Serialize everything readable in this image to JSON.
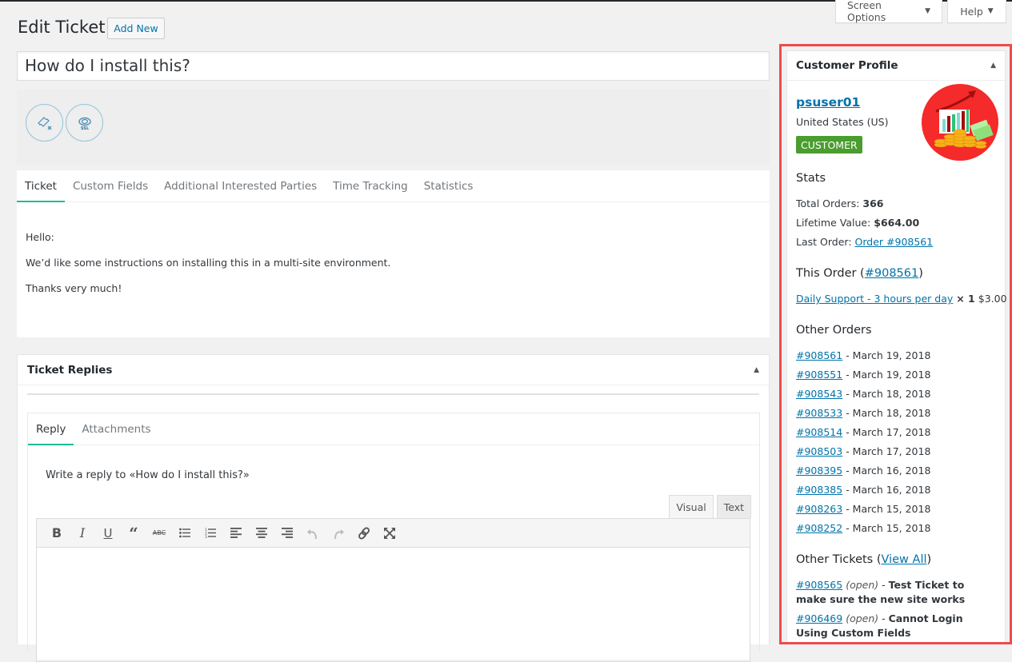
{
  "screen_meta": {
    "screen_options_label": "Screen Options",
    "help_label": "Help"
  },
  "header": {
    "title": "Edit Ticket",
    "add_new_label": "Add New"
  },
  "ticket": {
    "title_value": "How do I install this?",
    "action_icons": [
      "ticket-close-icon",
      "ssl-lock-icon"
    ],
    "tabs": [
      {
        "label": "Ticket",
        "active": true
      },
      {
        "label": "Custom Fields",
        "active": false
      },
      {
        "label": "Additional Interested Parties",
        "active": false
      },
      {
        "label": "Time Tracking",
        "active": false
      },
      {
        "label": "Statistics",
        "active": false
      }
    ],
    "body": [
      "Hello:",
      "We’d like some instructions on installing this in a multi-site environment.",
      "Thanks very much!"
    ]
  },
  "replies": {
    "title": "Ticket Replies",
    "tabs": [
      {
        "label": "Reply",
        "active": true
      },
      {
        "label": "Attachments",
        "active": false
      }
    ],
    "prompt": "Write a reply to «How do I install this?»",
    "editor_tabs": [
      {
        "label": "Visual",
        "active": true
      },
      {
        "label": "Text",
        "active": false
      }
    ],
    "toolbar": [
      {
        "name": "bold-icon",
        "glyph": "B"
      },
      {
        "name": "italic-icon",
        "glyph": "I"
      },
      {
        "name": "underline-icon",
        "glyph": "U"
      },
      {
        "name": "blockquote-icon",
        "glyph": "❝"
      },
      {
        "name": "strikethrough-icon",
        "glyph": "ABC"
      },
      {
        "name": "bullet-list-icon",
        "glyph": "•≡"
      },
      {
        "name": "numbered-list-icon",
        "glyph": "1≡"
      },
      {
        "name": "align-left-icon",
        "glyph": "≡"
      },
      {
        "name": "align-center-icon",
        "glyph": "≡"
      },
      {
        "name": "align-right-icon",
        "glyph": "≡"
      },
      {
        "name": "undo-icon",
        "glyph": "↶"
      },
      {
        "name": "redo-icon",
        "glyph": "↷"
      },
      {
        "name": "link-icon",
        "glyph": "🔗"
      },
      {
        "name": "fullscreen-icon",
        "glyph": "⤢"
      }
    ]
  },
  "profile": {
    "title": "Customer Profile",
    "username": "psuser01",
    "country": "United States (US)",
    "role_badge": "CUSTOMER",
    "badge_color": "#4a9d2f",
    "stats": {
      "heading": "Stats",
      "total_orders_label": "Total Orders:",
      "total_orders": "366",
      "lifetime_value_label": "Lifetime Value:",
      "lifetime_value": "$664.00",
      "last_order_label": "Last Order:",
      "last_order_link": "Order #908561"
    },
    "this_order": {
      "heading_prefix": "This Order (",
      "order_link": "#908561",
      "heading_suffix": ")",
      "item_link": "Daily Support - 3 hours per day",
      "item_qty": "× 1",
      "item_price": "$3.00"
    },
    "other_orders": {
      "heading": "Other Orders",
      "items": [
        {
          "id": "#908561",
          "date": "- March 19, 2018"
        },
        {
          "id": "#908551",
          "date": "- March 19, 2018"
        },
        {
          "id": "#908543",
          "date": "- March 18, 2018"
        },
        {
          "id": "#908533",
          "date": "- March 18, 2018"
        },
        {
          "id": "#908514",
          "date": "- March 17, 2018"
        },
        {
          "id": "#908503",
          "date": "- March 17, 2018"
        },
        {
          "id": "#908395",
          "date": "- March 16, 2018"
        },
        {
          "id": "#908385",
          "date": "- March 16, 2018"
        },
        {
          "id": "#908263",
          "date": "- March 15, 2018"
        },
        {
          "id": "#908252",
          "date": "- March 15, 2018"
        }
      ]
    },
    "other_tickets": {
      "heading_prefix": "Other Tickets (",
      "view_all": "View All",
      "heading_suffix": ")",
      "items": [
        {
          "id": "#908565",
          "status": "(open)",
          "sep": " - ",
          "subject": "Test Ticket to make sure the new site works"
        },
        {
          "id": "#906469",
          "status": "(open)",
          "sep": " - ",
          "subject": "Cannot Login Using Custom Fields"
        }
      ]
    }
  },
  "colors": {
    "accent_tab": "#1ebc9c",
    "link": "#0073aa",
    "highlight_frame": "#f14a4a"
  }
}
